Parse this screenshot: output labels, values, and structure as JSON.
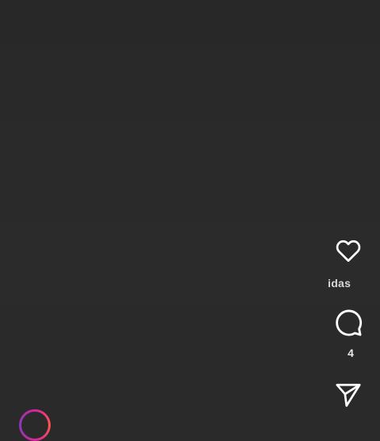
{
  "reel": {
    "likes_label": "idas",
    "comment_count": "4"
  },
  "icons": {
    "like": "heart-outline-icon",
    "comment": "speech-bubble-icon",
    "share": "paper-plane-icon"
  },
  "colors": {
    "background": "#2a2a2a",
    "icon_stroke": "#ffffff",
    "avatar_ring": "#d6249f"
  }
}
